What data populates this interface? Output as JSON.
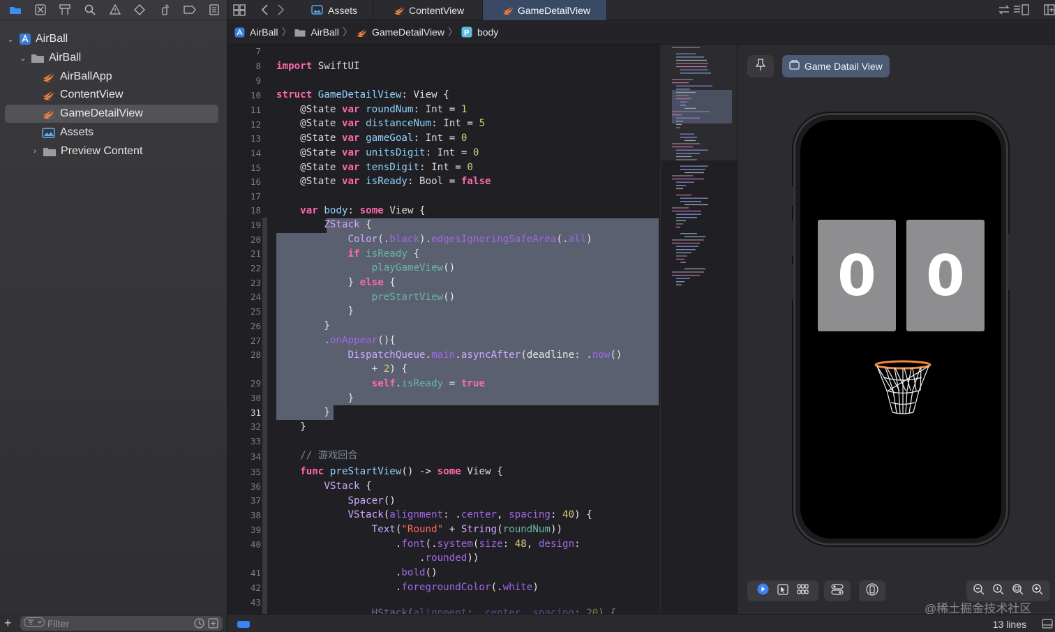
{
  "navigator": {
    "toolbar_icons": [
      "folder-icon",
      "source-control-icon",
      "hierarchy-icon",
      "search-icon",
      "warning-icon",
      "test-diamond-icon",
      "debug-spray-icon",
      "breakpoint-icon",
      "report-icon"
    ],
    "tree": [
      {
        "label": "AirBall",
        "icon": "project-icon",
        "expanded": true
      },
      {
        "label": "AirBall",
        "icon": "group-folder-icon",
        "expanded": true
      },
      {
        "label": "AirBallApp",
        "icon": "swift-file-icon"
      },
      {
        "label": "ContentView",
        "icon": "swift-file-icon"
      },
      {
        "label": "GameDetailView",
        "icon": "swift-file-icon",
        "selected": true
      },
      {
        "label": "Assets",
        "icon": "asset-catalog-icon"
      },
      {
        "label": "Preview Content",
        "icon": "group-folder-icon",
        "expanded": false
      }
    ],
    "filter_placeholder": "Filter"
  },
  "tabs": [
    {
      "label": "Assets",
      "icon": "asset-catalog-icon"
    },
    {
      "label": "ContentView",
      "icon": "swift-file-icon"
    },
    {
      "label": "GameDetailView",
      "icon": "swift-file-icon",
      "active": true
    }
  ],
  "jumpbar": [
    "AirBall",
    "AirBall",
    "GameDetailView",
    "body"
  ],
  "code": {
    "line_numbers": [
      "7",
      "8",
      "9",
      "10",
      "11",
      "12",
      "13",
      "14",
      "15",
      "16",
      "17",
      "18",
      "19",
      "20",
      "21",
      "22",
      "23",
      "24",
      "25",
      "26",
      "27",
      "28",
      "",
      "29",
      "30",
      "31",
      "32",
      "33",
      "34",
      "35",
      "36",
      "37",
      "38",
      "39",
      "40",
      "",
      "41",
      "42",
      "43"
    ]
  },
  "preview": {
    "pin_label": "Game Datail View",
    "score_digits": [
      "0",
      "0"
    ]
  },
  "status": {
    "lines": "13 lines",
    "watermark": "@稀土掘金技术社区"
  },
  "colors": {
    "accent": "#3b82f6",
    "selection": "#5a6070",
    "keyword": "#fc6aab",
    "type": "#d0a8ff",
    "number": "#d9c97c",
    "string": "#fc6a5d"
  }
}
